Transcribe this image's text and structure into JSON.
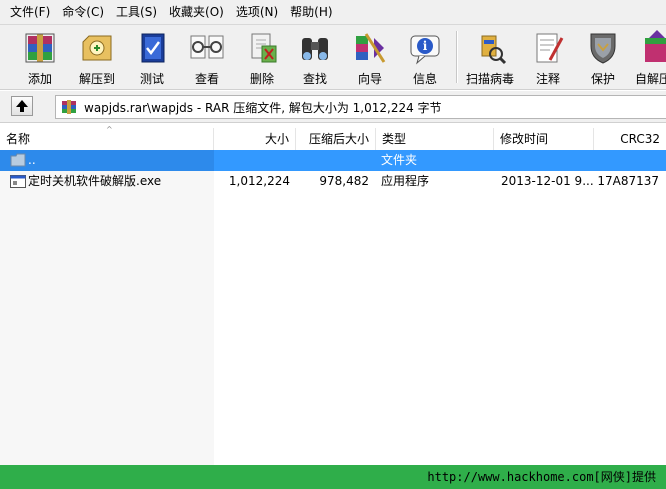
{
  "menu": [
    "文件(F)",
    "命令(C)",
    "工具(S)",
    "收藏夹(O)",
    "选项(N)",
    "帮助(H)"
  ],
  "toolbar": {
    "buttons": [
      {
        "label": "添加",
        "icon": "add-archive-icon"
      },
      {
        "label": "解压到",
        "icon": "extract-to-icon"
      },
      {
        "label": "测试",
        "icon": "test-icon"
      },
      {
        "label": "查看",
        "icon": "view-icon"
      },
      {
        "label": "删除",
        "icon": "delete-icon"
      },
      {
        "label": "查找",
        "icon": "find-binoculars-icon"
      },
      {
        "label": "向导",
        "icon": "wizard-icon"
      },
      {
        "label": "信息",
        "icon": "info-icon"
      },
      {
        "label": "扫描病毒",
        "icon": "virus-scan-icon"
      },
      {
        "label": "注释",
        "icon": "comment-icon"
      },
      {
        "label": "保护",
        "icon": "protect-shield-icon"
      },
      {
        "label": "自解压",
        "icon": "self-extract-icon"
      }
    ]
  },
  "address": {
    "text": "wapjds.rar\\wapjds - RAR 压缩文件, 解包大小为 1,012,224 字节"
  },
  "columns": {
    "name": "名称",
    "size": "大小",
    "packed": "压缩后大小",
    "type": "类型",
    "modified": "修改时间",
    "crc": "CRC32"
  },
  "rows": [
    {
      "name": "..",
      "size": "",
      "packed": "",
      "type": "文件夹",
      "modified": "",
      "crc": "",
      "selected": true
    },
    {
      "name": "定时关机软件破解版.exe",
      "size": "1,012,224",
      "packed": "978,482",
      "type": "应用程序",
      "modified": "2013-12-01 9...",
      "crc": "17A87137",
      "selected": false
    }
  ],
  "footer": {
    "watermark": "http://www.hackhome.com[网侠]提供"
  },
  "colors": {
    "selection": "#3399ff",
    "footer_bg": "#2fae4a"
  }
}
